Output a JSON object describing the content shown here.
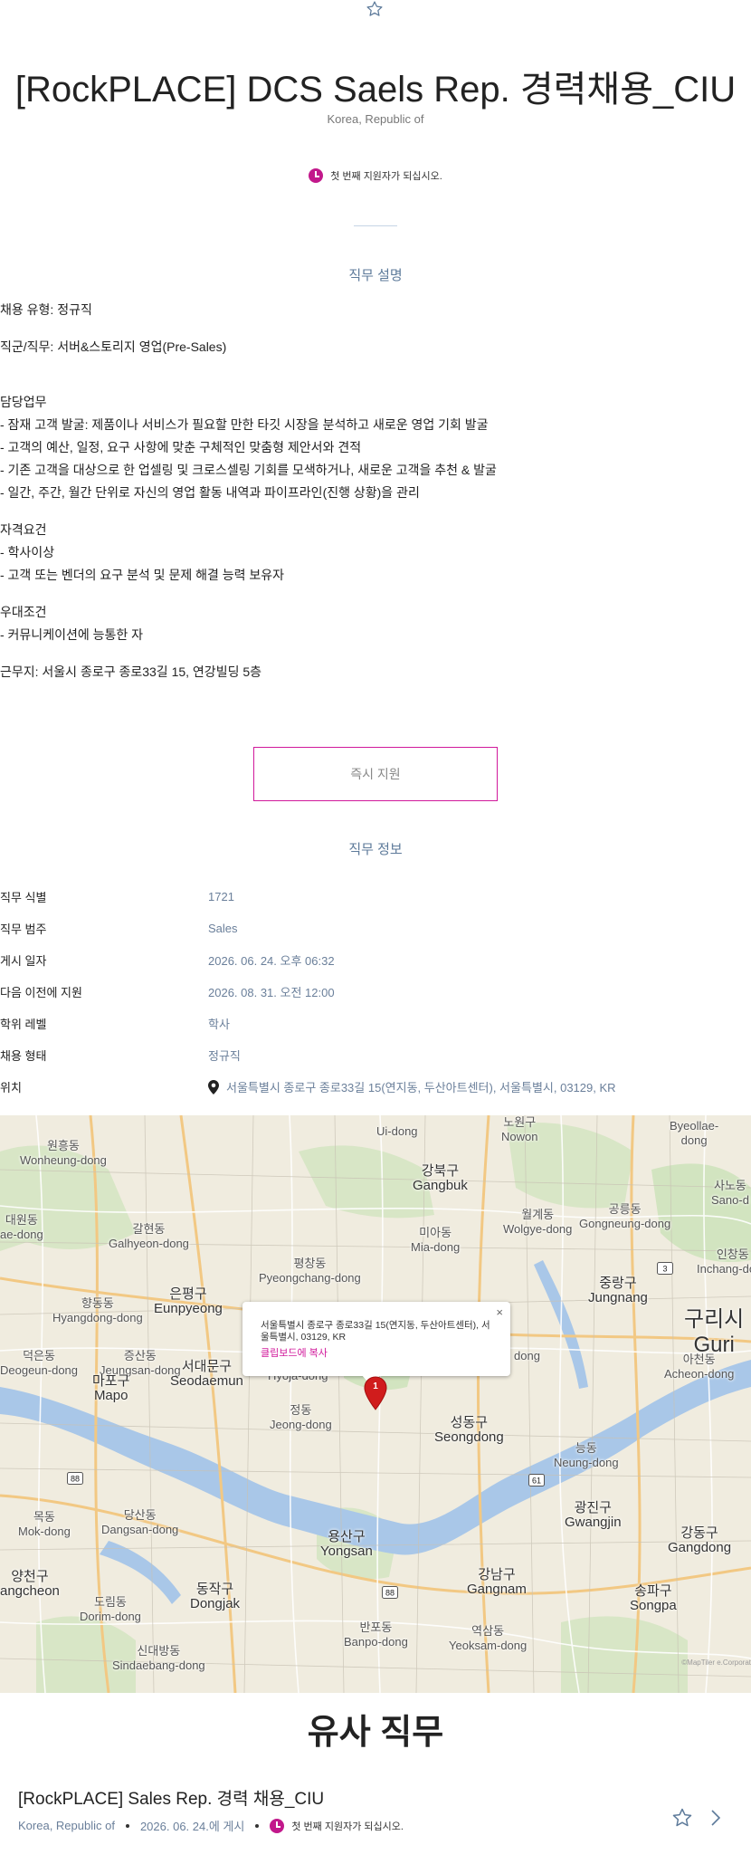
{
  "header": {
    "title": "[RockPLACE] DCS Saels Rep. 경력채용_CIU",
    "country": "Korea, Republic of",
    "applicant_note": "첫 번째 지원자가 되십시오."
  },
  "description": {
    "heading": "직무 설명",
    "employment_type": "채용 유형: 정규직",
    "job_category": "직군/직무: 서버&스토리지 영업(Pre-Sales)",
    "duties_title": "담당업무",
    "duties": [
      " - 잠재 고객 발굴: 제품이나 서비스가 필요할 만한 타깃 시장을 분석하고 새로운 영업 기회 발굴",
      " - 고객의 예산, 일정, 요구 사항에 맞춘 구체적인 맞춤형 제안서와 견적",
      " - 기존 고객을 대상으로 한 업셀링 및 크로스셀링 기회를 모색하거나, 새로운 고객을 추천 & 발굴",
      " - 일간, 주간, 월간 단위로 자신의 영업 활동 내역과 파이프라인(진행 상황)을 관리"
    ],
    "qualifications_title": "자격요건",
    "qualifications": [
      " - 학사이상",
      " - 고객 또는 벤더의 요구 분석 및 문제 해결 능력 보유자"
    ],
    "preferred_title": "우대조건",
    "preferred": [
      " - 커뮤니케이션에 능통한 자"
    ],
    "location": "근무지: 서울시 종로구 종로33길 15, 연강빌딩 5층"
  },
  "apply_button": "즉시 지원",
  "info": {
    "heading": "직무 정보",
    "rows": [
      {
        "label": "직무 식별",
        "value": "1721"
      },
      {
        "label": "직무 범주",
        "value": "Sales"
      },
      {
        "label": "게시 일자",
        "value": "2026. 06. 24. 오후 06:32"
      },
      {
        "label": "다음 이전에 지원",
        "value": "2026. 08. 31. 오전 12:00"
      },
      {
        "label": "학위 레벨",
        "value": "학사"
      },
      {
        "label": "채용 형태",
        "value": "정규직"
      },
      {
        "label": "위치",
        "value": "서울특별시 종로구 종로33길 15(연지동, 두산아트센터), 서울특별시, 03129, KR"
      }
    ]
  },
  "map": {
    "popup_address": "서울특별시 종로구 종로33길 15(연지동, 두산아트센터), 서울특별시, 03129, KR",
    "popup_copy": "클립보드에 복사",
    "popup_close": "×",
    "marker_number": "1",
    "attribution": "©MapTiler e.Corporat",
    "labels": [
      {
        "ko": "원흥동",
        "en": "Wonheung-dong"
      },
      {
        "ko": "Ui-dong",
        "en": ""
      },
      {
        "ko": "노원구",
        "en": "Nowon"
      },
      {
        "ko": "Byeollae-",
        "en": "dong"
      },
      {
        "ko": "강북구",
        "en": "Gangbuk"
      },
      {
        "ko": "월계동",
        "en": "Wolgye-dong"
      },
      {
        "ko": "공릉동",
        "en": "Gongneung-dong"
      },
      {
        "ko": "사노동",
        "en": "Sano-d"
      },
      {
        "ko": "대원동",
        "en": "ae-dong"
      },
      {
        "ko": "갈현동",
        "en": "Galhyeon-dong"
      },
      {
        "ko": "미아동",
        "en": "Mia-dong"
      },
      {
        "ko": "평창동",
        "en": "Pyeongchang-dong"
      },
      {
        "ko": "인창동",
        "en": "Inchang-dong"
      },
      {
        "ko": "향동동",
        "en": "Hyangdong-dong"
      },
      {
        "ko": "은평구",
        "en": "Eunpyeong"
      },
      {
        "ko": "중랑구",
        "en": "Jungnang"
      },
      {
        "ko": "구리시",
        "en": "Guri"
      },
      {
        "ko": "덕은동",
        "en": "Deogeun-dong"
      },
      {
        "ko": "증산동",
        "en": "Jeungsan-dong"
      },
      {
        "ko": "서대문구",
        "en": "Seodaemun"
      },
      {
        "ko": "Hyoja-dong",
        "en": ""
      },
      {
        "ko": "dong",
        "en": ""
      },
      {
        "ko": "아천동",
        "en": "Acheon-dong"
      },
      {
        "ko": "마포구",
        "en": "Mapo"
      },
      {
        "ko": "정동",
        "en": "Jeong-dong"
      },
      {
        "ko": "성동구",
        "en": "Seongdong"
      },
      {
        "ko": "능동",
        "en": "Neung-dong"
      },
      {
        "ko": "목동",
        "en": "Mok-dong"
      },
      {
        "ko": "당산동",
        "en": "Dangsan-dong"
      },
      {
        "ko": "광진구",
        "en": "Gwangjin"
      },
      {
        "ko": "강동구",
        "en": "Gangdong"
      },
      {
        "ko": "용산구",
        "en": "Yongsan"
      },
      {
        "ko": "양천구",
        "en": "angcheon"
      },
      {
        "ko": "도림동",
        "en": "Dorim-dong"
      },
      {
        "ko": "동작구",
        "en": "Dongjak"
      },
      {
        "ko": "강남구",
        "en": "Gangnam"
      },
      {
        "ko": "송파구",
        "en": "Songpa"
      },
      {
        "ko": "반포동",
        "en": "Banpo-dong"
      },
      {
        "ko": "역삼동",
        "en": "Yeoksam-dong"
      },
      {
        "ko": "신대방동",
        "en": "Sindaebang-dong"
      }
    ],
    "road_shields": [
      "88",
      "61",
      "88",
      "3"
    ]
  },
  "similar": {
    "heading": "유사 직무",
    "job_title": "[RockPLACE] Sales Rep. 경력 채용_CIU",
    "country": "Korea, Republic of",
    "posted": "2026. 06. 24.에 게시",
    "applicant_note": "첫 번째 지원자가 되십시오."
  },
  "colors": {
    "accent": "#d1199b",
    "meta_blue": "#6a7f9a",
    "heading_blue": "#5d7a9a",
    "river": "#a9c7e8",
    "map_land": "#f0ecdf",
    "park": "#d2e4c0"
  },
  "icons": [
    "star-icon",
    "clock-icon",
    "map-pin-icon",
    "map-marker-icon",
    "chevron-right-icon"
  ]
}
